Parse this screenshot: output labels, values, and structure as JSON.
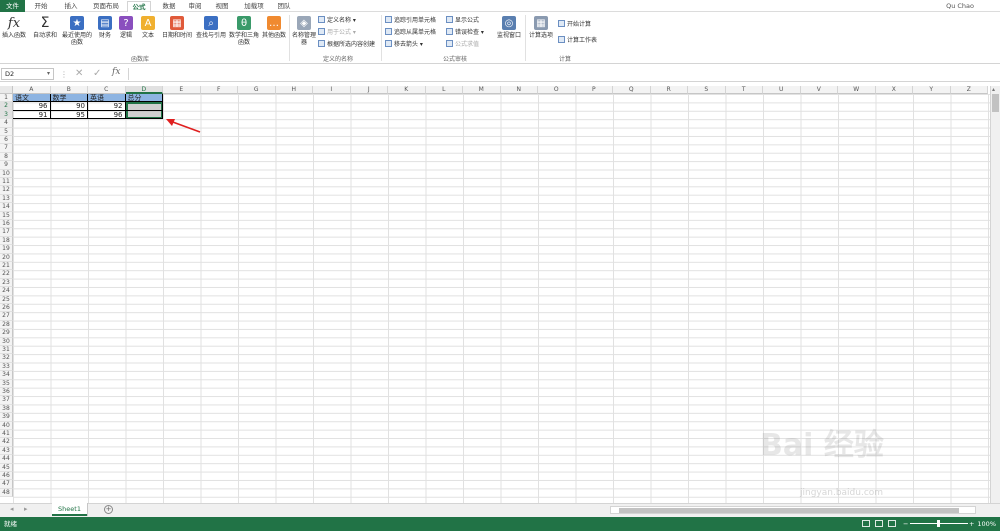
{
  "tabs": [
    "文件",
    "开始",
    "插入",
    "页面布局",
    "公式",
    "数据",
    "审阅",
    "视图",
    "加载项",
    "团队"
  ],
  "active_tab": "公式",
  "user": "Qu Chao",
  "ribbon": {
    "insert_function": "插入函数",
    "autosum": "自动求和",
    "recent": "最近使用的函数",
    "financial": "财务",
    "logical": "逻辑",
    "text": "文本",
    "datetime": "日期和时间",
    "lookup": "查找与引用",
    "math": "数学和三角函数",
    "other": "其他函数",
    "group_library": "函数库",
    "name_manager": "名称管理器",
    "define_name": "定义名称",
    "use_in_formula": "用于公式",
    "create_from_selection": "根据所选内容创建",
    "group_names": "定义的名称",
    "trace_precedents": "追踪引用单元格",
    "trace_dependents": "追踪从属单元格",
    "remove_arrows": "移去箭头",
    "show_formulas": "显示公式",
    "error_checking": "错误检查",
    "evaluate_formula": "公式求值",
    "group_audit": "公式审核",
    "watch_window": "监视窗口",
    "calc_options": "计算选项",
    "calc_now": "开始计算",
    "calc_sheet": "计算工作表",
    "group_calc": "计算"
  },
  "name_box": "D2",
  "fx_label": "fx",
  "columns": [
    "A",
    "B",
    "C",
    "D",
    "E",
    "F",
    "G",
    "H",
    "I",
    "J",
    "K",
    "L",
    "M",
    "N",
    "O",
    "P",
    "Q",
    "R",
    "S",
    "T",
    "U",
    "V",
    "W",
    "X",
    "Y",
    "Z"
  ],
  "selected_column": "D",
  "row_count": 48,
  "cells": {
    "A1": "语文",
    "B1": "数学",
    "C1": "英语",
    "D1": "总分",
    "A2": "96",
    "B2": "90",
    "C2": "92",
    "A3": "91",
    "B3": "95",
    "C3": "96"
  },
  "sheet_tab": "Sheet1",
  "status": "就绪",
  "zoom": "100%",
  "watermark": "Bai 经验",
  "watermark_url": "jingyan.baidu.com",
  "colors": {
    "excel_green": "#217346",
    "header_fill": "#8db4e2",
    "selection": "#aaaaaa",
    "arrow": "#e02020"
  }
}
